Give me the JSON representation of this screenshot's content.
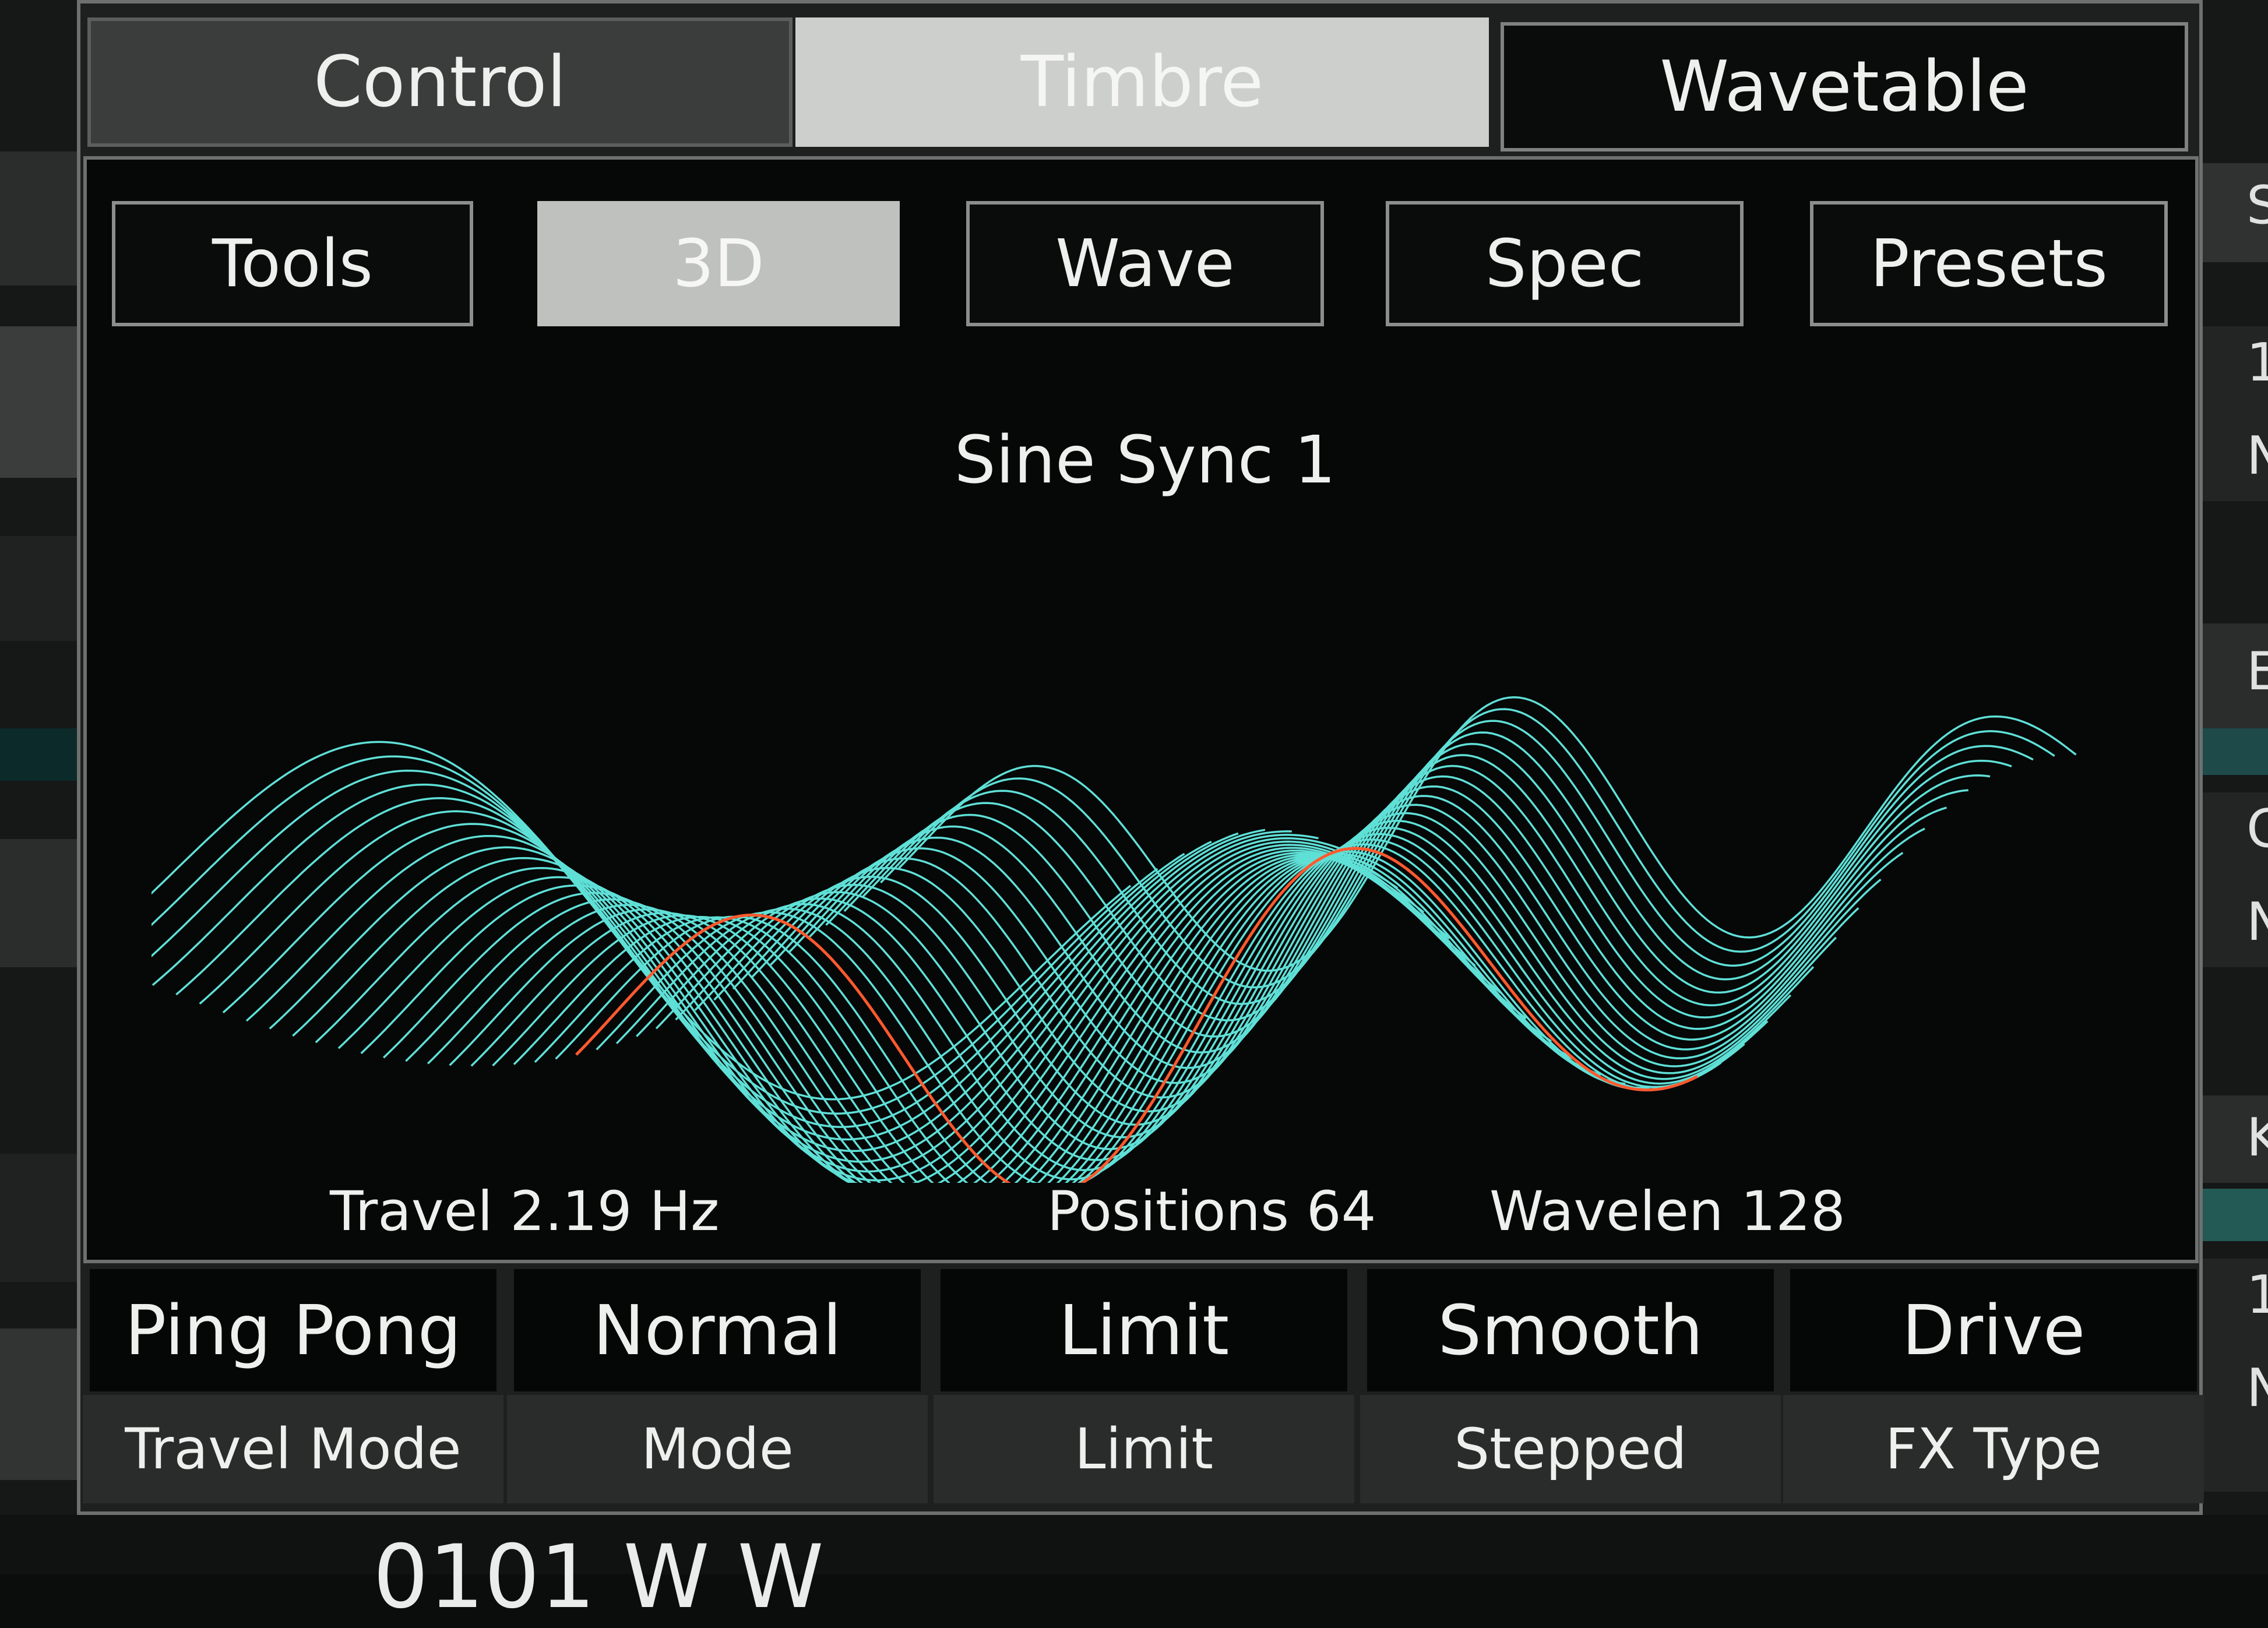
{
  "tabs": {
    "control": "Control",
    "timbre": "Timbre",
    "wavetable": "Wavetable"
  },
  "subtabs": {
    "tools": "Tools",
    "view_3d": "3D",
    "wave": "Wave",
    "spec": "Spec",
    "presets": "Presets"
  },
  "wavetable": {
    "name": "Sine Sync 1",
    "travel": "Travel 2.19 Hz",
    "positions": "Positions 64",
    "wavelen": "Wavelen 128",
    "colors": {
      "mesh": "#5fe0d7",
      "playhead": "#ff5a2e"
    }
  },
  "controls": [
    {
      "value": "Ping Pong",
      "label": "Travel Mode"
    },
    {
      "value": "Normal",
      "label": "Mode"
    },
    {
      "value": "Limit",
      "label": "Limit"
    },
    {
      "value": "Smooth",
      "label": "Stepped"
    },
    {
      "value": "Drive",
      "label": "FX Type"
    }
  ],
  "side_right": [
    "S",
    "1",
    "N",
    "E",
    "C",
    "N",
    "K",
    "1",
    "N"
  ],
  "bottom_partial": "0101 W      W"
}
